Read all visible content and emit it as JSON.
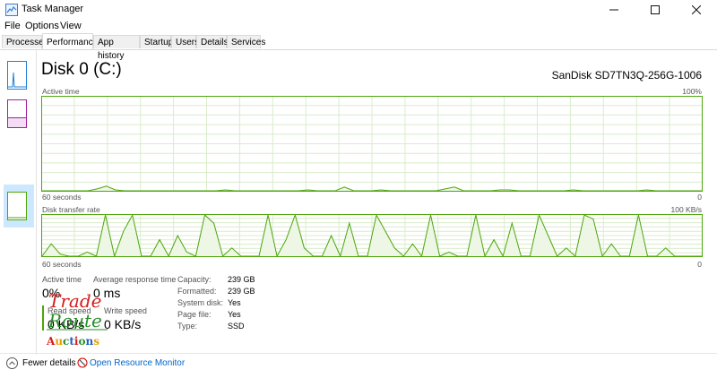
{
  "window": {
    "title": "Task Manager",
    "controls": [
      "minimize",
      "maximize",
      "close"
    ]
  },
  "menu": [
    "File",
    "Options",
    "View"
  ],
  "tabs": [
    "Processes",
    "Performance",
    "App history",
    "Startup",
    "Users",
    "Details",
    "Services"
  ],
  "active_tab": "Performance",
  "disk": {
    "title": "Disk 0 (C:)",
    "model": "SanDisk SD7TN3Q-256G-1006",
    "active_time_graph": {
      "label": "Active time",
      "max": "100%",
      "time": "60 seconds",
      "min": "0",
      "values": [
        0,
        0,
        0,
        0,
        0,
        0,
        2,
        5,
        1,
        0,
        0,
        0,
        0,
        0,
        0,
        0,
        0,
        0,
        0,
        0,
        1,
        0,
        0,
        0,
        0,
        0,
        0,
        0,
        0,
        1,
        0,
        0,
        0,
        4,
        0,
        0,
        0,
        1,
        0,
        0,
        0,
        0,
        0,
        0,
        2,
        4,
        0,
        0,
        0,
        0,
        1,
        1,
        0,
        0,
        0,
        0,
        0,
        0,
        1,
        0,
        0,
        0,
        0,
        0,
        0,
        0,
        1,
        0,
        0,
        0,
        0,
        0,
        0
      ]
    },
    "transfer_graph": {
      "label": "Disk transfer rate",
      "max": "100 KB/s",
      "time": "60 seconds",
      "min": "0",
      "values": [
        0,
        30,
        5,
        0,
        0,
        10,
        0,
        100,
        0,
        60,
        100,
        0,
        0,
        40,
        0,
        50,
        10,
        0,
        100,
        80,
        0,
        20,
        0,
        0,
        0,
        100,
        0,
        40,
        100,
        20,
        0,
        0,
        50,
        0,
        80,
        0,
        0,
        100,
        60,
        20,
        0,
        30,
        0,
        100,
        0,
        10,
        0,
        0,
        100,
        0,
        40,
        0,
        80,
        0,
        0,
        100,
        50,
        0,
        20,
        0,
        100,
        90,
        0,
        30,
        0,
        0,
        100,
        0,
        0,
        20,
        0,
        0,
        0,
        0
      ]
    },
    "stats": {
      "active_time_label": "Active time",
      "active_time_value": "0%",
      "response_label": "Average response time",
      "response_value": "0 ms",
      "read_label": "Read speed",
      "read_value": "0 KB/s",
      "write_label": "Write speed",
      "write_value": "0 KB/s"
    },
    "properties": [
      {
        "k": "Capacity:",
        "v": "239 GB"
      },
      {
        "k": "Formatted:",
        "v": "239 GB"
      },
      {
        "k": "System disk:",
        "v": "Yes"
      },
      {
        "k": "Page file:",
        "v": "Yes"
      },
      {
        "k": "Type:",
        "v": "SSD"
      }
    ]
  },
  "overlay_logo": [
    "Trade",
    "Route",
    "Auctions"
  ],
  "footer": {
    "fewer_details": "Fewer details",
    "resource_monitor": "Open Resource Monitor"
  },
  "colors": {
    "accent": "#4da60c",
    "grid": "#d9eccb",
    "fill": "#eef7e6"
  }
}
